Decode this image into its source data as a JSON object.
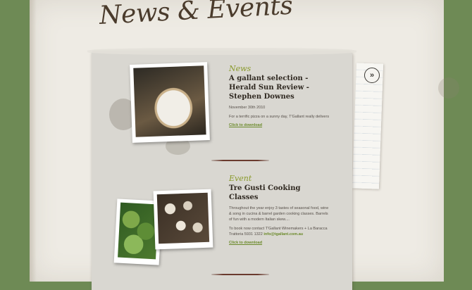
{
  "page": {
    "heading": "News & Events",
    "next_label": "»"
  },
  "items": [
    {
      "category": "News",
      "title": "A gallant selection - Herald Sun Review - Stephen Downes",
      "date": "November 30th 2010",
      "body": "For a terrific pizza on a sunny day, T'Gallant really delivers",
      "download": "Click to download"
    },
    {
      "category": "Event",
      "title": "Tre Gusti Cooking Classes",
      "body": "Throughout the year enjoy 3 tastes of seasonal food, wine & song in cucina & barrel garden cooking classes. Barrels of fun with a modern Italian skew....",
      "contact_prefix": "To book now contact T'Gallant Winemakers + La Baracca Trattoria 5931 1322",
      "email": "info@tgallant.com.au",
      "download": "Click to download"
    }
  ],
  "icons": {
    "next": "chevron-double-right-icon"
  }
}
